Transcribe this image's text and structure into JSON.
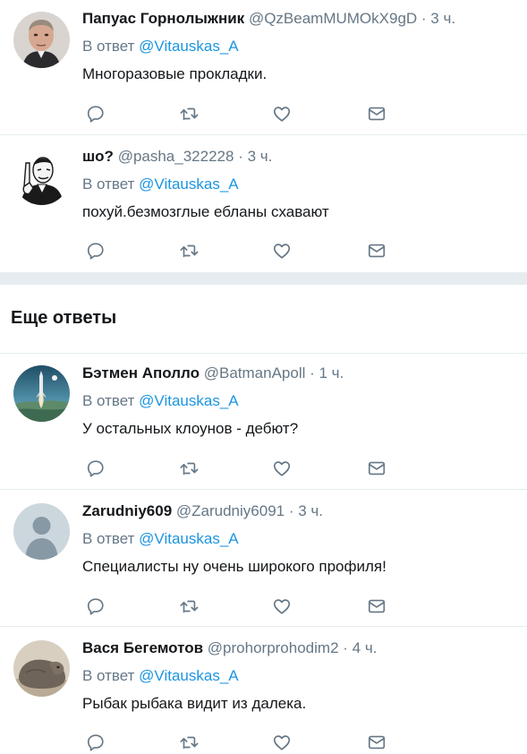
{
  "tweets_top": [
    {
      "name": "Папуас Горнолыжник",
      "handle": "@QzBeamMUMOkX9gD",
      "time": "· 3 ч.",
      "replying_prefix": "В ответ ",
      "replying_to": "@Vitauskas_A",
      "text": "Многоразовые прокладки."
    },
    {
      "name": "шо?",
      "handle": "@pasha_322228",
      "time": "· 3 ч.",
      "replying_prefix": "В ответ ",
      "replying_to": "@Vitauskas_A",
      "text": "похуй.безмозглые ебланы схавают"
    }
  ],
  "section_title": "Еще ответы",
  "tweets_more": [
    {
      "name": "Бэтмен Аполло",
      "handle": "@BatmanApoll",
      "time": "· 1 ч.",
      "replying_prefix": "В ответ ",
      "replying_to": "@Vitauskas_A",
      "text": "У остальных клоунов - дебют?"
    },
    {
      "name": "Zarudniy609",
      "handle": "@Zarudniy6091",
      "time": "· 3 ч.",
      "replying_prefix": "В ответ ",
      "replying_to": "@Vitauskas_A",
      "text": "Специалисты ну очень широкого профиля!"
    },
    {
      "name": "Вася Бегемотов",
      "handle": "@prohorprohodim2",
      "time": "· 4 ч.",
      "replying_prefix": "В ответ ",
      "replying_to": "@Vitauskas_A",
      "text": "Рыбак рыбака видит из далека."
    }
  ],
  "icons": {
    "reply": "reply-icon",
    "retweet": "retweet-icon",
    "like": "heart-icon",
    "dm": "envelope-icon"
  },
  "colors": {
    "link": "#1b95e0",
    "secondary_text": "#657786",
    "divider": "#e6ecf0"
  }
}
